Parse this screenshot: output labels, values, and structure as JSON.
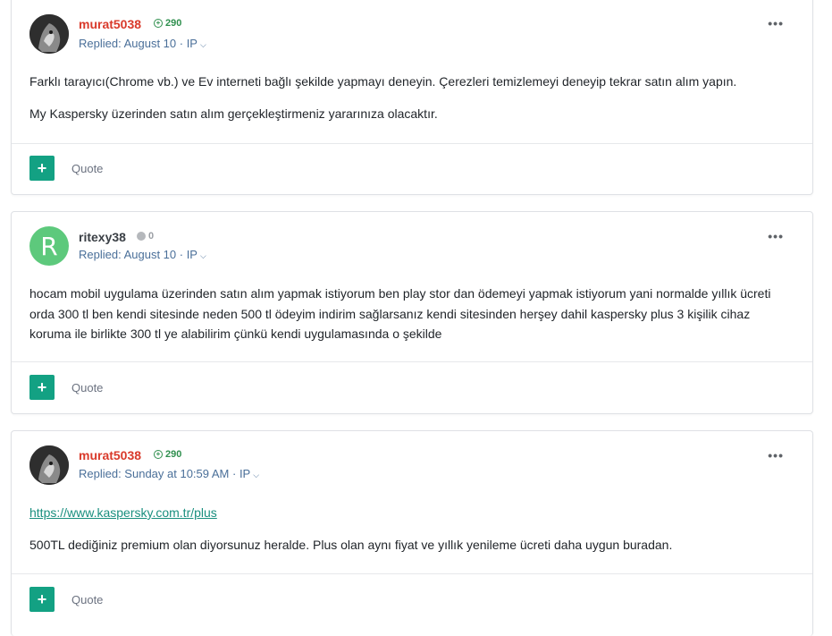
{
  "posts": [
    {
      "username": "murat5038",
      "reputation": "290",
      "reply_meta": "Replied: August 10 · IP",
      "paragraphs": [
        "Farklı tarayıcı(Chrome vb.) ve Ev interneti bağlı şekilde yapmayı deneyin. Çerezleri temizlemeyi deneyip tekrar satın alım yapın.",
        "My Kaspersky üzerinden satın alım gerçekleştirmeniz yararınıza olacaktır."
      ],
      "quote_label": "Quote",
      "menu_icon": "more-dots-icon",
      "add_icon": "plus-icon"
    },
    {
      "username": "ritexy38",
      "avatar_letter": "R",
      "reputation": "0",
      "reply_meta": "Replied: August 10 · IP",
      "paragraphs": [
        "hocam mobil uygulama üzerinden satın alım yapmak istiyorum ben play stor dan ödemeyi yapmak istiyorum yani normalde yıllık ücreti orda 300 tl ben kendi sitesinde neden 500 tl ödeyim indirim sağlarsanız kendi sitesinden herşey dahil kaspersky plus 3 kişilik cihaz koruma ile birlikte 300 tl ye alabilirim çünkü kendi uygulamasında o şekilde"
      ],
      "quote_label": "Quote"
    },
    {
      "username": "murat5038",
      "reputation": "290",
      "reply_meta": "Replied: Sunday at 10:59 AM · IP",
      "link": "https://www.kaspersky.com.tr/plus",
      "paragraphs": [
        "500TL dediğiniz premium olan diyorsunuz heralde. Plus olan aynı fiyat ve yıllık yenileme ücreti daha uygun buradan."
      ],
      "quote_label": "Quote"
    }
  ],
  "colors": {
    "accent": "#13a183",
    "username_red": "#d93a2b",
    "reputation_green": "#2f8f4e",
    "meta_blue": "#4a6f99",
    "avatar_green": "#5dc97c"
  }
}
